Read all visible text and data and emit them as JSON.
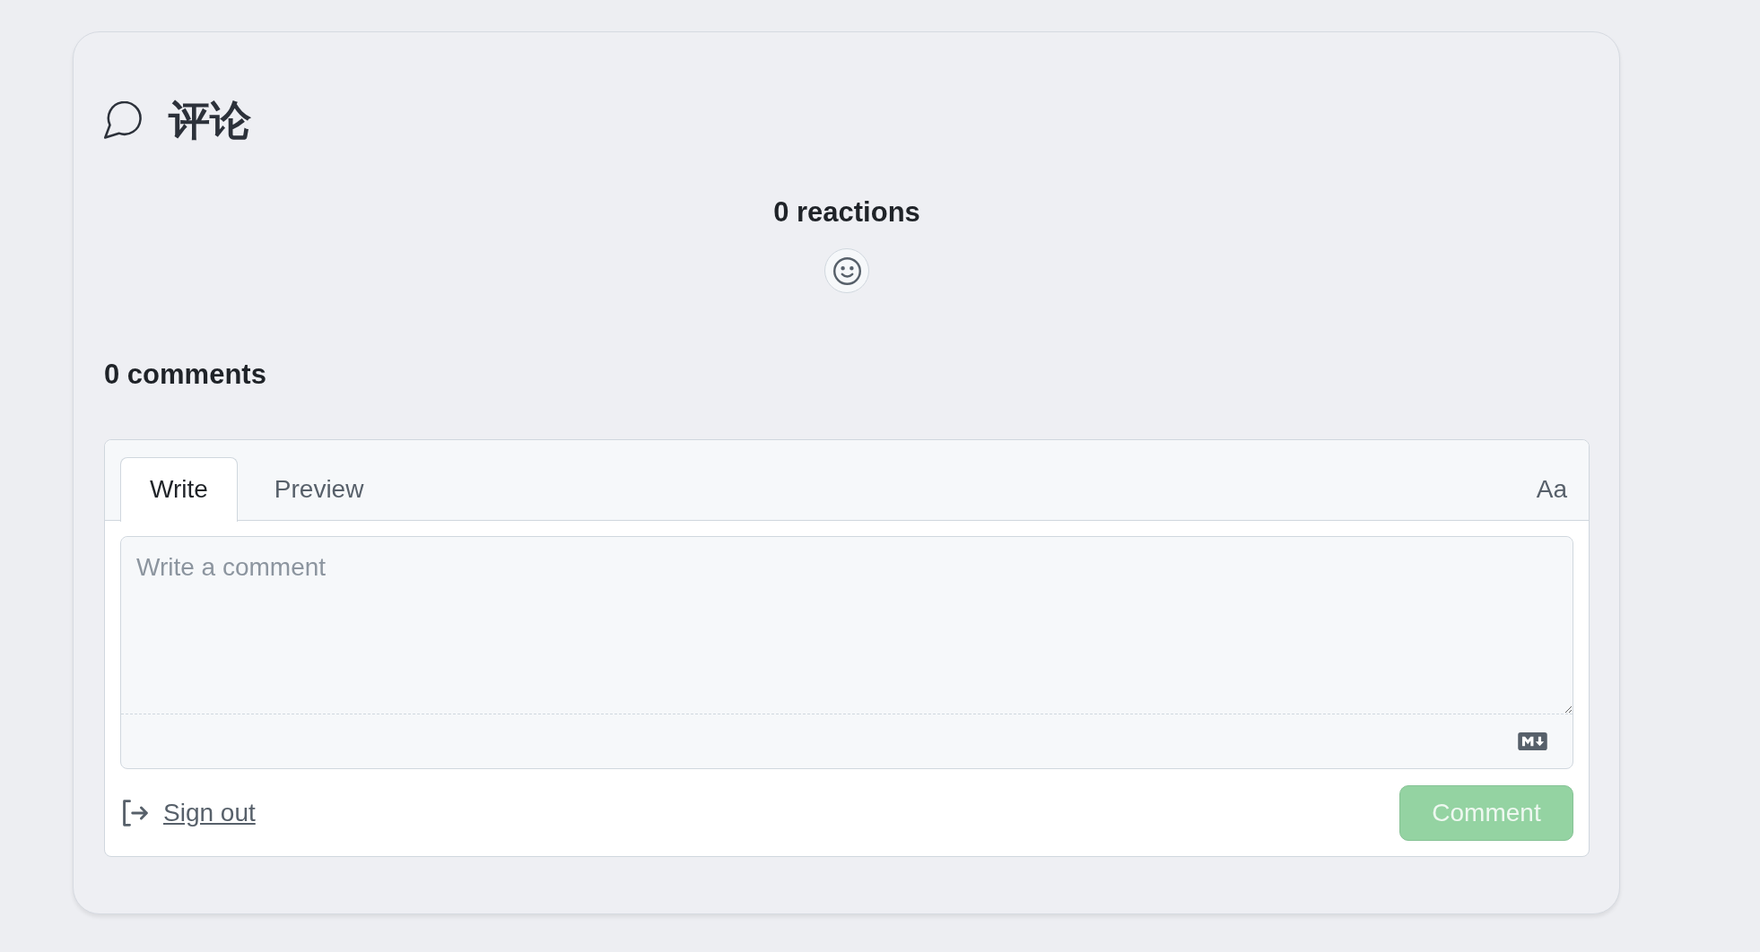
{
  "header": {
    "title": "评论"
  },
  "reactions": {
    "summary": "0 reactions"
  },
  "comments_heading": "0 comments",
  "editor": {
    "tabs": [
      {
        "label": "Write",
        "selected": true
      },
      {
        "label": "Preview",
        "selected": false
      }
    ],
    "format_button": "Aa",
    "comment_field": {
      "placeholder": "Write a comment"
    }
  },
  "footer": {
    "sign_out_link": "Sign out",
    "submit_button": {
      "label": "Comment",
      "disabled": true
    }
  }
}
